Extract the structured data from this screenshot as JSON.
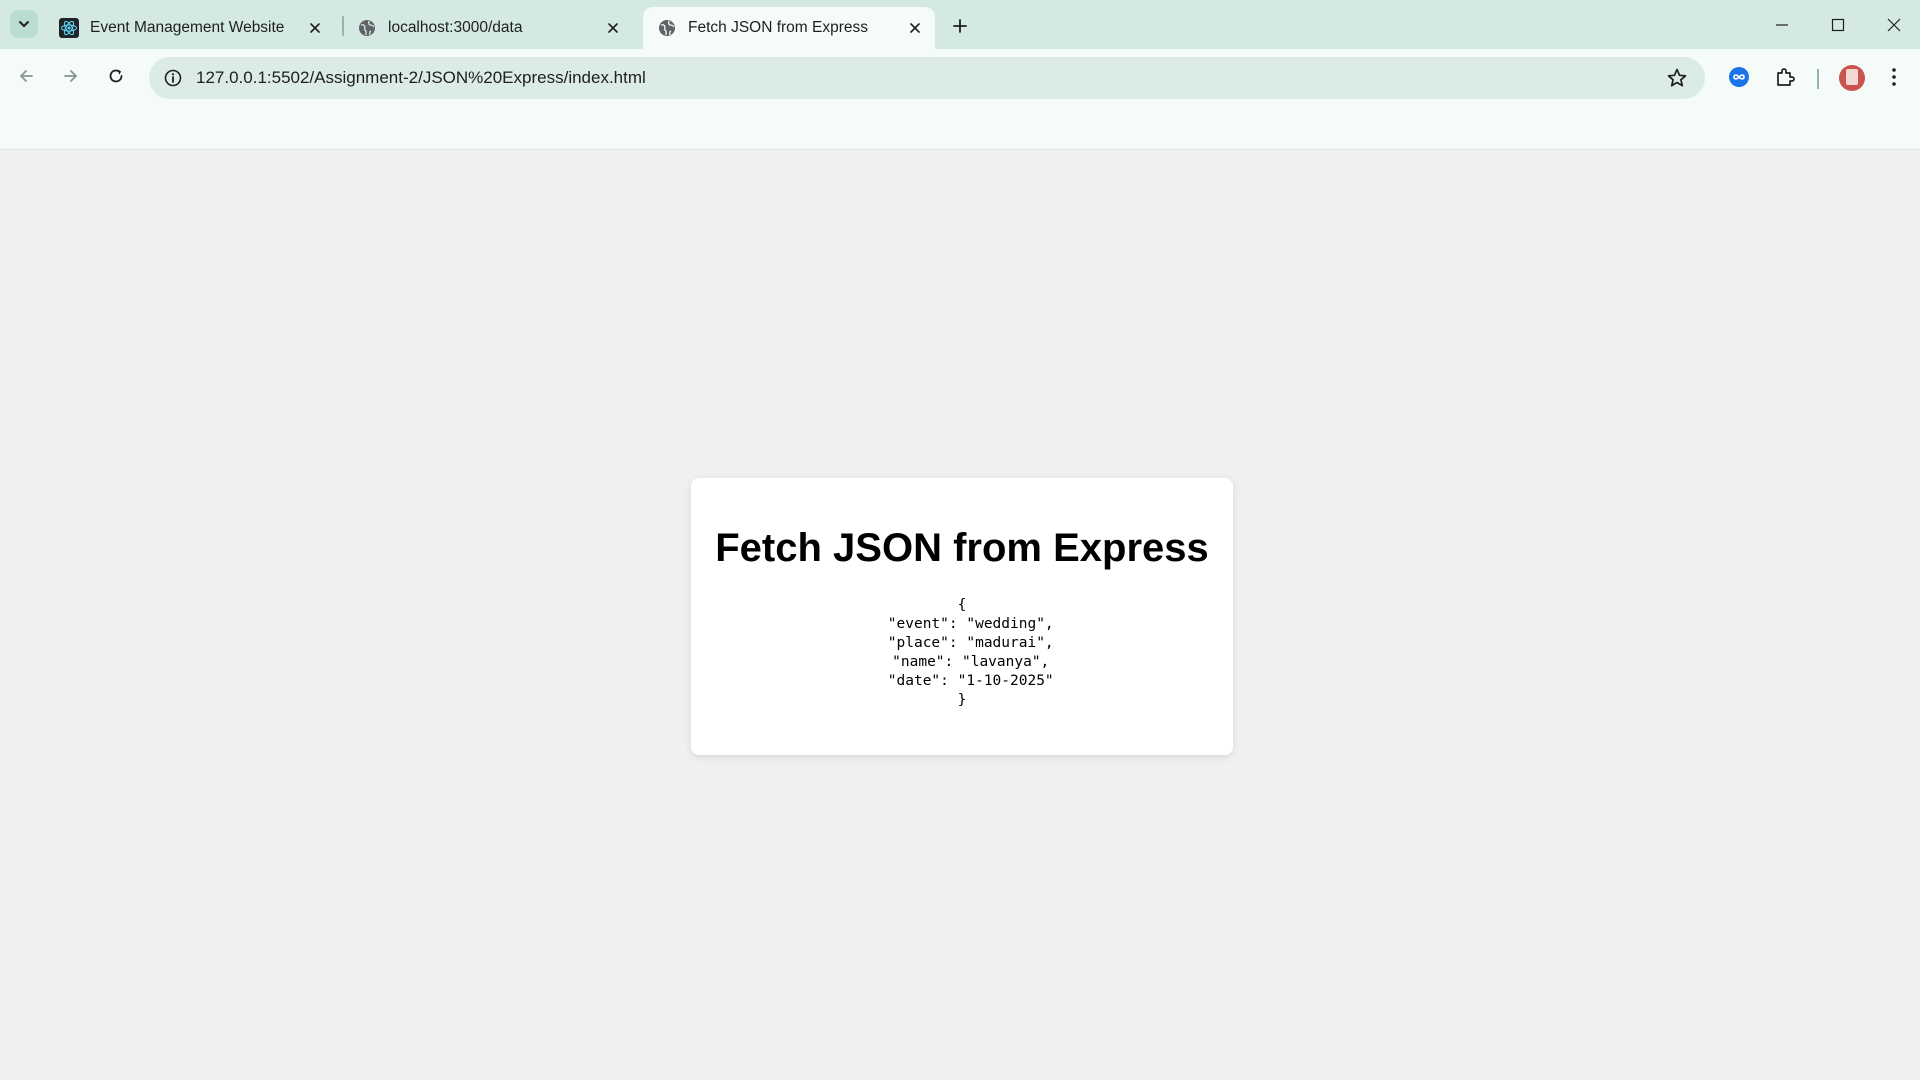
{
  "browser": {
    "tabs": [
      {
        "title": "Event Management Website",
        "favicon": "react-icon",
        "active": false
      },
      {
        "title": "localhost:3000/data",
        "favicon": "globe-icon",
        "active": false
      },
      {
        "title": "Fetch JSON from Express",
        "favicon": "globe-icon",
        "active": true
      }
    ],
    "url": "127.0.0.1:5502/Assignment-2/JSON%20Express/index.html"
  },
  "page": {
    "heading": "Fetch JSON from Express",
    "json_output": "{\n  \"event\": \"wedding\",\n  \"place\": \"madurai\",\n  \"name\": \"lavanya\",\n  \"date\": \"1-10-2025\"\n}"
  },
  "colors": {
    "tabstrip": "#d3e9e2",
    "toolbar": "#f5fbf8",
    "page_background": "#f0f0f0",
    "card": "#ffffff"
  }
}
